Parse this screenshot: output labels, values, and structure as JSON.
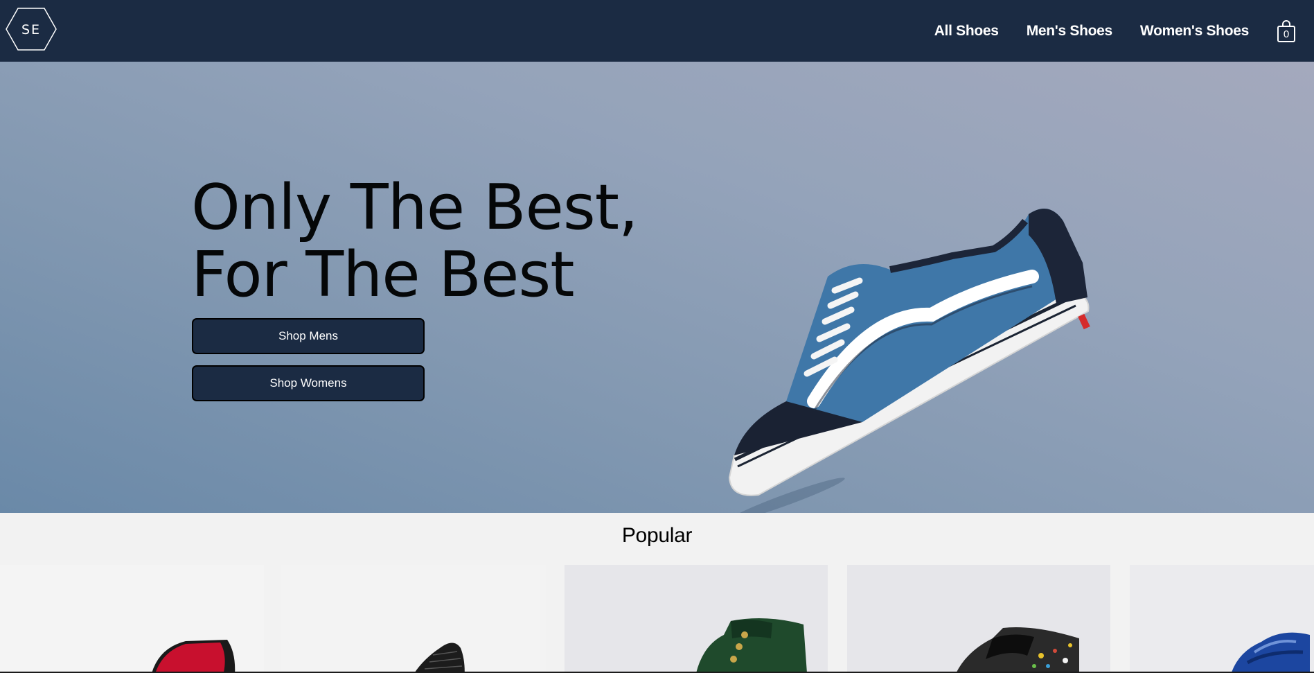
{
  "brand": {
    "logo_text": "SE"
  },
  "nav": {
    "links": [
      "All Shoes",
      "Men's Shoes",
      "Women's Shoes"
    ],
    "cart_count": "0"
  },
  "hero": {
    "headline_line1": "Only The Best,",
    "headline_line2": "For The Best",
    "shop_mens": "Shop Mens",
    "shop_womens": "Shop Womens"
  },
  "popular": {
    "title": "Popular",
    "products": [
      {
        "icon": "red-black-sneaker",
        "color": "#c8102e"
      },
      {
        "icon": "black-knit-sneaker",
        "color": "#1c1c1c"
      },
      {
        "icon": "green-hightop-sneaker",
        "color": "#1f4a2c"
      },
      {
        "icon": "paint-splatter-sneaker",
        "color": "#2a2a2a"
      },
      {
        "icon": "blue-sneaker",
        "color": "#1c46a0"
      }
    ]
  },
  "colors": {
    "nav_bg": "#1b2b43",
    "button_bg": "#1b2b43",
    "page_bg": "#f2f2f2"
  }
}
